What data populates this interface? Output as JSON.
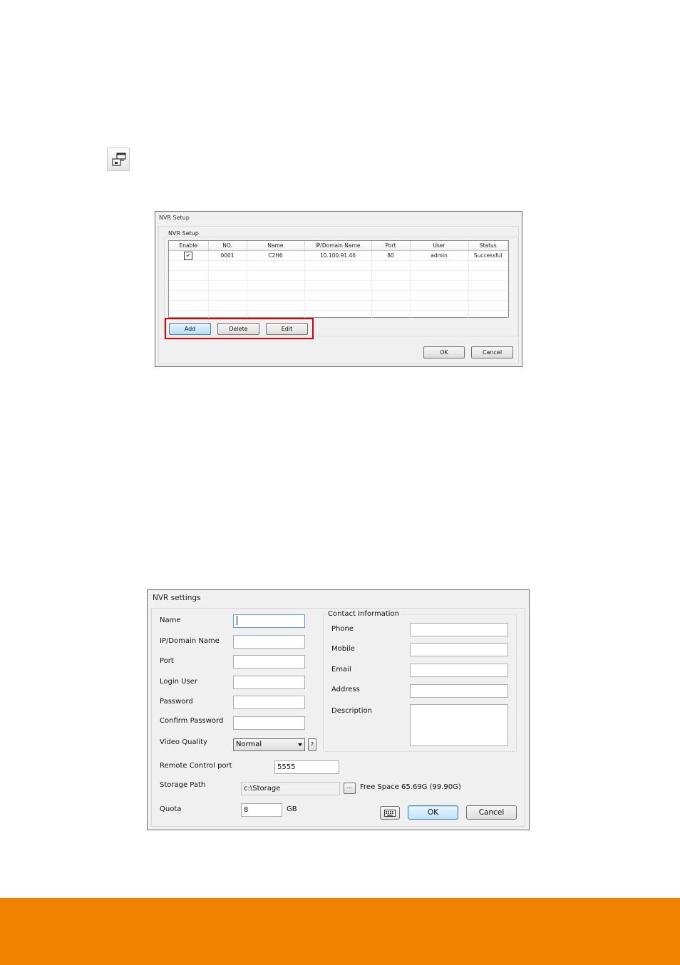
{
  "nvr_setup": {
    "title": "NVR Setup",
    "group_label": "NVR Setup",
    "columns": [
      "Enable",
      "NO.",
      "Name",
      "IP/Domain Name",
      "Port",
      "User",
      "Status"
    ],
    "rows": [
      {
        "enabled": true,
        "check_glyph": "✔",
        "no": "0001",
        "name": "C2H6",
        "ip": "10.100.91.46",
        "port": "80",
        "user": "admin",
        "status": "Successful"
      }
    ],
    "buttons": {
      "add": "Add",
      "delete": "Delete",
      "edit": "Edit",
      "ok": "OK",
      "cancel": "Cancel"
    }
  },
  "nvr_settings": {
    "title": "NVR settings",
    "fields": {
      "name": {
        "label": "Name",
        "value": ""
      },
      "ip": {
        "label": "IP/Domain Name",
        "value": ""
      },
      "port": {
        "label": "Port",
        "value": ""
      },
      "login_user": {
        "label": "Login User",
        "value": ""
      },
      "password": {
        "label": "Password",
        "value": ""
      },
      "confirm_password": {
        "label": "Confirm Password",
        "value": ""
      },
      "video_quality": {
        "label": "Video Quality",
        "value": "Normal"
      },
      "remote_control_port": {
        "label": "Remote Control port",
        "value": "5555"
      },
      "storage_path": {
        "label": "Storage Path",
        "value": "c:\\Storage"
      },
      "quota": {
        "label": "Quota",
        "value": "8",
        "unit": "GB"
      }
    },
    "help_label": "?",
    "browse_label": "...",
    "free_space": "Free Space 65.69G (99.90G)",
    "contact": {
      "label": "Contact Information",
      "phone": {
        "label": "Phone",
        "value": ""
      },
      "mobile": {
        "label": "Mobile",
        "value": ""
      },
      "email": {
        "label": "Email",
        "value": ""
      },
      "address": {
        "label": "Address",
        "value": ""
      },
      "description": {
        "label": "Description",
        "value": ""
      }
    },
    "buttons": {
      "ok": "OK",
      "cancel": "Cancel"
    }
  },
  "icons": {
    "toolbar": "nvr-setup-icon",
    "keyboard": "keyboard-icon"
  },
  "colors": {
    "footer": "#ef8200",
    "highlight": "#e00000"
  }
}
